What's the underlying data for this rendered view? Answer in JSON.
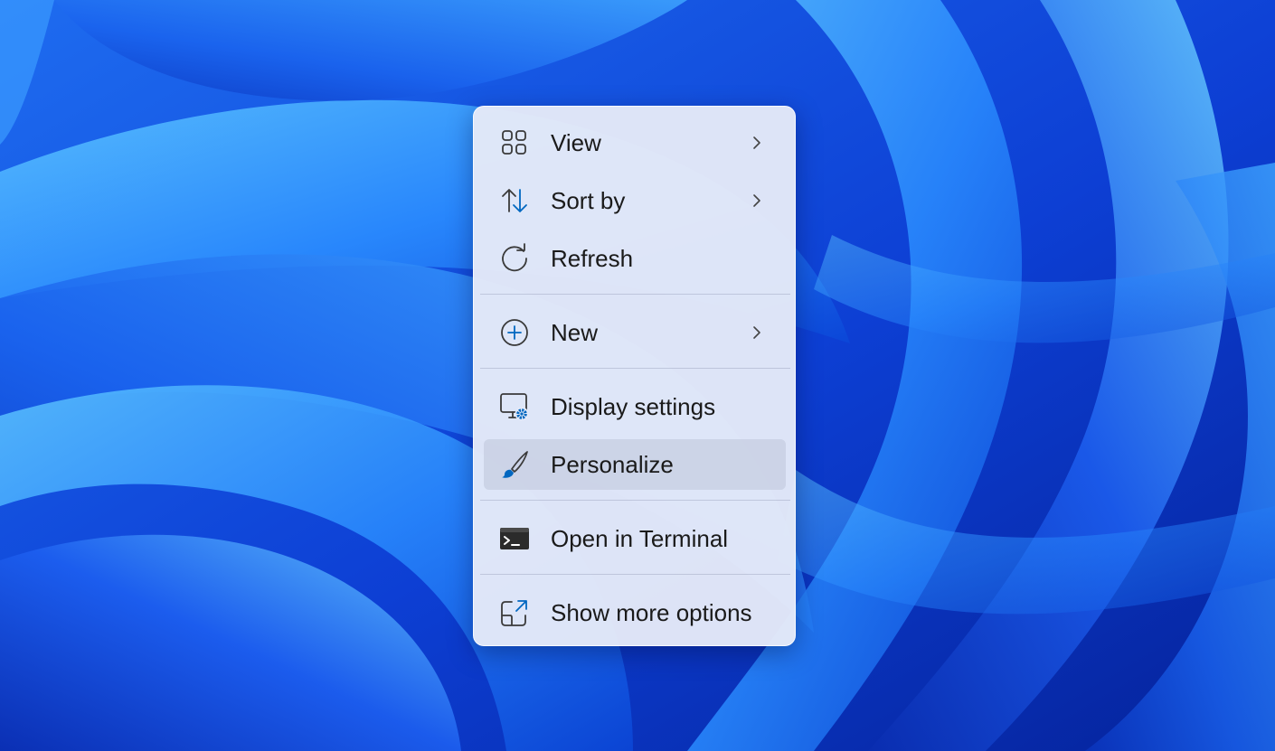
{
  "colors": {
    "accent": "#0067c0",
    "menu_background": "#e4e9f8",
    "text": "#1a1a1a",
    "wallpaper_blue": "#0a37c8"
  },
  "context_menu": {
    "items": [
      {
        "label": "View",
        "icon": "view-grid-icon",
        "has_submenu": true
      },
      {
        "label": "Sort by",
        "icon": "sort-arrows-icon",
        "has_submenu": true
      },
      {
        "label": "Refresh",
        "icon": "refresh-icon",
        "has_submenu": false
      },
      {
        "label": "New",
        "icon": "new-plus-circle-icon",
        "has_submenu": true
      },
      {
        "label": "Display settings",
        "icon": "display-settings-icon",
        "has_submenu": false
      },
      {
        "label": "Personalize",
        "icon": "paintbrush-icon",
        "has_submenu": false,
        "highlighted": true
      },
      {
        "label": "Open in Terminal",
        "icon": "terminal-icon",
        "has_submenu": false
      },
      {
        "label": "Show more options",
        "icon": "show-more-options-icon",
        "has_submenu": false
      }
    ]
  }
}
